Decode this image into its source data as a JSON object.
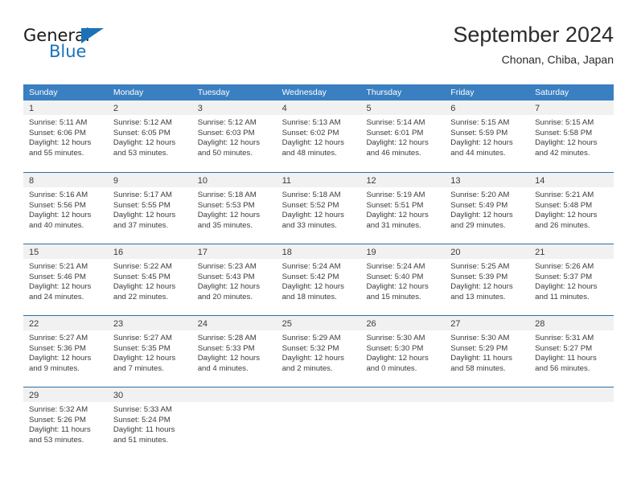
{
  "logo": {
    "word_dark": "General",
    "word_blue": "Blue",
    "triangle_icon": "blue-triangle-icon",
    "accent_color": "#1b72b8"
  },
  "header": {
    "title": "September 2024",
    "subtitle": "Chonan, Chiba, Japan"
  },
  "theme": {
    "header_blue": "#3a7fc1",
    "grid_line": "#2f6ea5",
    "day_band_gray": "#f1f1f1",
    "text": "#3b3b3b"
  },
  "weekdays": [
    "Sunday",
    "Monday",
    "Tuesday",
    "Wednesday",
    "Thursday",
    "Friday",
    "Saturday"
  ],
  "weeks": [
    [
      {
        "day": "1",
        "sunrise": "Sunrise: 5:11 AM",
        "sunset": "Sunset: 6:06 PM",
        "daylight_1": "Daylight: 12 hours",
        "daylight_2": "and 55 minutes."
      },
      {
        "day": "2",
        "sunrise": "Sunrise: 5:12 AM",
        "sunset": "Sunset: 6:05 PM",
        "daylight_1": "Daylight: 12 hours",
        "daylight_2": "and 53 minutes."
      },
      {
        "day": "3",
        "sunrise": "Sunrise: 5:12 AM",
        "sunset": "Sunset: 6:03 PM",
        "daylight_1": "Daylight: 12 hours",
        "daylight_2": "and 50 minutes."
      },
      {
        "day": "4",
        "sunrise": "Sunrise: 5:13 AM",
        "sunset": "Sunset: 6:02 PM",
        "daylight_1": "Daylight: 12 hours",
        "daylight_2": "and 48 minutes."
      },
      {
        "day": "5",
        "sunrise": "Sunrise: 5:14 AM",
        "sunset": "Sunset: 6:01 PM",
        "daylight_1": "Daylight: 12 hours",
        "daylight_2": "and 46 minutes."
      },
      {
        "day": "6",
        "sunrise": "Sunrise: 5:15 AM",
        "sunset": "Sunset: 5:59 PM",
        "daylight_1": "Daylight: 12 hours",
        "daylight_2": "and 44 minutes."
      },
      {
        "day": "7",
        "sunrise": "Sunrise: 5:15 AM",
        "sunset": "Sunset: 5:58 PM",
        "daylight_1": "Daylight: 12 hours",
        "daylight_2": "and 42 minutes."
      }
    ],
    [
      {
        "day": "8",
        "sunrise": "Sunrise: 5:16 AM",
        "sunset": "Sunset: 5:56 PM",
        "daylight_1": "Daylight: 12 hours",
        "daylight_2": "and 40 minutes."
      },
      {
        "day": "9",
        "sunrise": "Sunrise: 5:17 AM",
        "sunset": "Sunset: 5:55 PM",
        "daylight_1": "Daylight: 12 hours",
        "daylight_2": "and 37 minutes."
      },
      {
        "day": "10",
        "sunrise": "Sunrise: 5:18 AM",
        "sunset": "Sunset: 5:53 PM",
        "daylight_1": "Daylight: 12 hours",
        "daylight_2": "and 35 minutes."
      },
      {
        "day": "11",
        "sunrise": "Sunrise: 5:18 AM",
        "sunset": "Sunset: 5:52 PM",
        "daylight_1": "Daylight: 12 hours",
        "daylight_2": "and 33 minutes."
      },
      {
        "day": "12",
        "sunrise": "Sunrise: 5:19 AM",
        "sunset": "Sunset: 5:51 PM",
        "daylight_1": "Daylight: 12 hours",
        "daylight_2": "and 31 minutes."
      },
      {
        "day": "13",
        "sunrise": "Sunrise: 5:20 AM",
        "sunset": "Sunset: 5:49 PM",
        "daylight_1": "Daylight: 12 hours",
        "daylight_2": "and 29 minutes."
      },
      {
        "day": "14",
        "sunrise": "Sunrise: 5:21 AM",
        "sunset": "Sunset: 5:48 PM",
        "daylight_1": "Daylight: 12 hours",
        "daylight_2": "and 26 minutes."
      }
    ],
    [
      {
        "day": "15",
        "sunrise": "Sunrise: 5:21 AM",
        "sunset": "Sunset: 5:46 PM",
        "daylight_1": "Daylight: 12 hours",
        "daylight_2": "and 24 minutes."
      },
      {
        "day": "16",
        "sunrise": "Sunrise: 5:22 AM",
        "sunset": "Sunset: 5:45 PM",
        "daylight_1": "Daylight: 12 hours",
        "daylight_2": "and 22 minutes."
      },
      {
        "day": "17",
        "sunrise": "Sunrise: 5:23 AM",
        "sunset": "Sunset: 5:43 PM",
        "daylight_1": "Daylight: 12 hours",
        "daylight_2": "and 20 minutes."
      },
      {
        "day": "18",
        "sunrise": "Sunrise: 5:24 AM",
        "sunset": "Sunset: 5:42 PM",
        "daylight_1": "Daylight: 12 hours",
        "daylight_2": "and 18 minutes."
      },
      {
        "day": "19",
        "sunrise": "Sunrise: 5:24 AM",
        "sunset": "Sunset: 5:40 PM",
        "daylight_1": "Daylight: 12 hours",
        "daylight_2": "and 15 minutes."
      },
      {
        "day": "20",
        "sunrise": "Sunrise: 5:25 AM",
        "sunset": "Sunset: 5:39 PM",
        "daylight_1": "Daylight: 12 hours",
        "daylight_2": "and 13 minutes."
      },
      {
        "day": "21",
        "sunrise": "Sunrise: 5:26 AM",
        "sunset": "Sunset: 5:37 PM",
        "daylight_1": "Daylight: 12 hours",
        "daylight_2": "and 11 minutes."
      }
    ],
    [
      {
        "day": "22",
        "sunrise": "Sunrise: 5:27 AM",
        "sunset": "Sunset: 5:36 PM",
        "daylight_1": "Daylight: 12 hours",
        "daylight_2": "and 9 minutes."
      },
      {
        "day": "23",
        "sunrise": "Sunrise: 5:27 AM",
        "sunset": "Sunset: 5:35 PM",
        "daylight_1": "Daylight: 12 hours",
        "daylight_2": "and 7 minutes."
      },
      {
        "day": "24",
        "sunrise": "Sunrise: 5:28 AM",
        "sunset": "Sunset: 5:33 PM",
        "daylight_1": "Daylight: 12 hours",
        "daylight_2": "and 4 minutes."
      },
      {
        "day": "25",
        "sunrise": "Sunrise: 5:29 AM",
        "sunset": "Sunset: 5:32 PM",
        "daylight_1": "Daylight: 12 hours",
        "daylight_2": "and 2 minutes."
      },
      {
        "day": "26",
        "sunrise": "Sunrise: 5:30 AM",
        "sunset": "Sunset: 5:30 PM",
        "daylight_1": "Daylight: 12 hours",
        "daylight_2": "and 0 minutes."
      },
      {
        "day": "27",
        "sunrise": "Sunrise: 5:30 AM",
        "sunset": "Sunset: 5:29 PM",
        "daylight_1": "Daylight: 11 hours",
        "daylight_2": "and 58 minutes."
      },
      {
        "day": "28",
        "sunrise": "Sunrise: 5:31 AM",
        "sunset": "Sunset: 5:27 PM",
        "daylight_1": "Daylight: 11 hours",
        "daylight_2": "and 56 minutes."
      }
    ],
    [
      {
        "day": "29",
        "sunrise": "Sunrise: 5:32 AM",
        "sunset": "Sunset: 5:26 PM",
        "daylight_1": "Daylight: 11 hours",
        "daylight_2": "and 53 minutes."
      },
      {
        "day": "30",
        "sunrise": "Sunrise: 5:33 AM",
        "sunset": "Sunset: 5:24 PM",
        "daylight_1": "Daylight: 11 hours",
        "daylight_2": "and 51 minutes."
      },
      {
        "day": "",
        "sunrise": "",
        "sunset": "",
        "daylight_1": "",
        "daylight_2": ""
      },
      {
        "day": "",
        "sunrise": "",
        "sunset": "",
        "daylight_1": "",
        "daylight_2": ""
      },
      {
        "day": "",
        "sunrise": "",
        "sunset": "",
        "daylight_1": "",
        "daylight_2": ""
      },
      {
        "day": "",
        "sunrise": "",
        "sunset": "",
        "daylight_1": "",
        "daylight_2": ""
      },
      {
        "day": "",
        "sunrise": "",
        "sunset": "",
        "daylight_1": "",
        "daylight_2": ""
      }
    ]
  ]
}
